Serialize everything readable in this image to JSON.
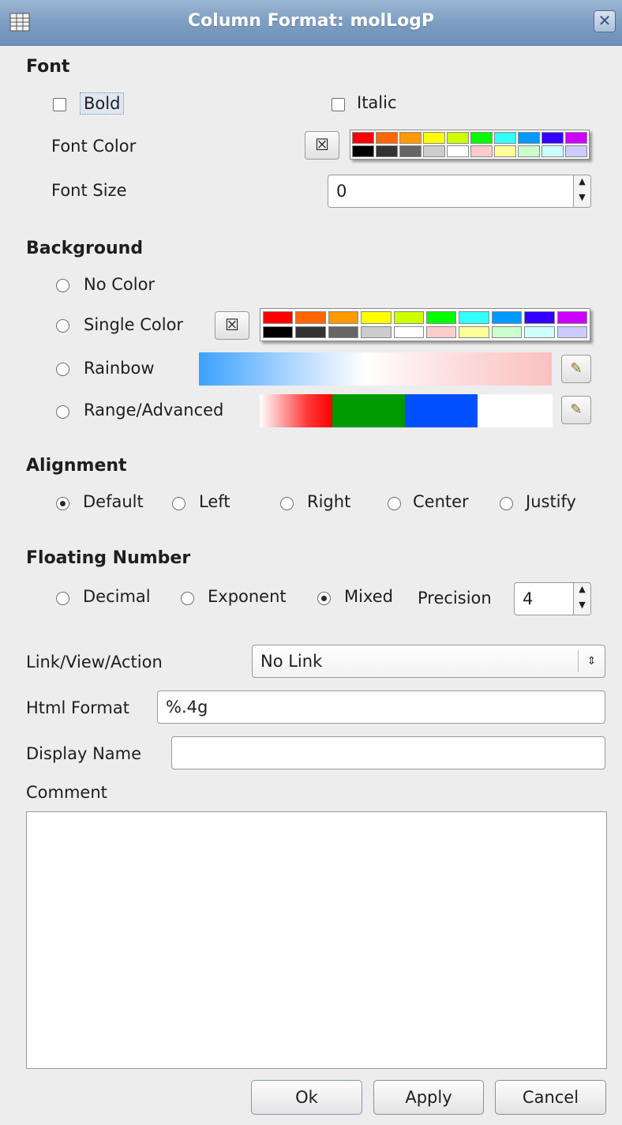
{
  "window": {
    "title": "Column Format: molLogP",
    "close_glyph": "✕"
  },
  "font": {
    "section": "Font",
    "bold_label": "Bold",
    "italic_label": "Italic",
    "color_label": "Font Color",
    "size_label": "Font Size",
    "size_value": "0"
  },
  "palette": {
    "top": [
      "#ff0000",
      "#ff6600",
      "#ff9900",
      "#ffff00",
      "#ccff00",
      "#00ff00",
      "#33ffff",
      "#0099ff",
      "#3300ff",
      "#cc00ff"
    ],
    "bottom": [
      "#000000",
      "#333333",
      "#666666",
      "#cccccc",
      "#ffffff",
      "#ffcccc",
      "#ffff99",
      "#ccffcc",
      "#ccffff",
      "#ccccff"
    ]
  },
  "background": {
    "section": "Background",
    "no_color": "No Color",
    "single_color": "Single Color",
    "rainbow": "Rainbow",
    "range": "Range/Advanced",
    "selected": "range"
  },
  "alignment": {
    "section": "Alignment",
    "options": [
      "Default",
      "Left",
      "Right",
      "Center",
      "Justify"
    ],
    "selected": "Default"
  },
  "floating": {
    "section": "Floating Number",
    "decimal": "Decimal",
    "exponent": "Exponent",
    "mixed": "Mixed",
    "selected": "Mixed",
    "precision_label": "Precision",
    "precision_value": "4"
  },
  "link": {
    "label": "Link/View/Action",
    "value": "No Link"
  },
  "html_format": {
    "label": "Html Format",
    "value": "%.4g"
  },
  "display_name": {
    "label": "Display Name",
    "value": ""
  },
  "comment": {
    "label": "Comment",
    "value": ""
  },
  "buttons": {
    "ok": "Ok",
    "apply": "Apply",
    "cancel": "Cancel"
  },
  "icons": {
    "close": "close-icon",
    "check_x": "☒"
  }
}
